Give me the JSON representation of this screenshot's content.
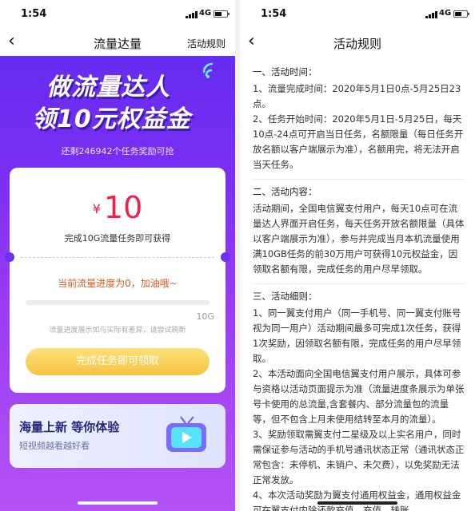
{
  "left": {
    "status": {
      "time": "1:54",
      "network": "4G"
    },
    "nav": {
      "back": "‹",
      "title": "流量达量",
      "link": "活动规则"
    },
    "banner": {
      "line1": "做流量达人",
      "line2": "领10元权益金"
    },
    "remaining": "还剩246942个任务奖励可抢",
    "reward": {
      "currency": "¥",
      "amount": "10",
      "desc": "完成10G流量任务即可获得"
    },
    "progress": {
      "text": "当前流量进度为0，加油哦~",
      "value": 0,
      "max_label": "10G",
      "note": "流量进度展示如与实际有差异，请尝试刷新"
    },
    "cta": "完成任务即可领取",
    "promo": {
      "title": "海量上新 等你体验",
      "subtitle": "短视频越看越好看"
    }
  },
  "right": {
    "status": {
      "time": "1:54",
      "network": "4G"
    },
    "nav": {
      "back": "‹",
      "title": "活动规则"
    },
    "sections": [
      {
        "heading": "一、活动时间：",
        "paragraphs": [
          "1、流量完成时间：2020年5月1日0点-5月25日23点。",
          "2、任务开始时间：2020年5月1日-5月25日，每天10点-24点可开启当日任务，名额限量（每日任务开放名额以客户端展示为准），名额用完，将无法开启当天任务。"
        ]
      },
      {
        "heading": "二、活动内容：",
        "paragraphs": [
          "活动期间，全国电信翼支付用户，每天10点可在流量达人界面开启任务，每天任务开放名额限量（具体以客户端展示为准），参与并完成当月本机流量使用满10GB任务的前30万用户可获得10元权益金，因领取名额有限，完成任务的用户尽早领取。"
        ]
      },
      {
        "heading": "三、活动细则：",
        "paragraphs": [
          "1、同一翼支付用户（同一手机号、同一翼支付账号视为同一用户）活动期间最多可完成1次任务，获得1次奖励，因领取名额有限，完成任务的用户尽早领取。",
          "2、本活动面向全国电信翼支付用户展示，具体可参与资格以活动页面提示为准（流量进度条展示为单张号卡使用的总流量,含套餐内、部分流量包的流量等，但不包含上月未使用结转至本月的流量）。",
          "3、奖励领取需翼支付二星级及以上实名用户，同时需保证参与活动的手机号通讯状态正常（通讯状态正常包含：未停机、未销户、未欠费），以免奖励无法正常发放。",
          "4、本次活动奖励为翼支付通用权益金，通用权益金可在翼支付内除还款充值、充值、转账、"
        ]
      }
    ]
  },
  "colors": {
    "accent_red": "#f0204a",
    "progress_orange": "#e05a1c",
    "cta_yellow": "#f4c441",
    "bg_purple": "#7a2ff2"
  }
}
